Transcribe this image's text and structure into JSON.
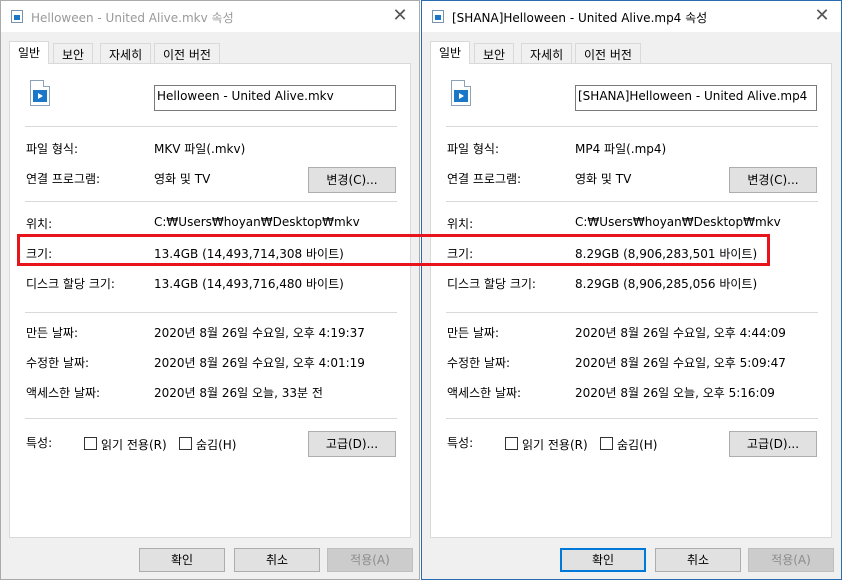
{
  "windows": [
    {
      "title": "Helloween - United Alive.mkv 속성",
      "tabs": [
        "일반",
        "보안",
        "자세히",
        "이전 버전"
      ],
      "file_name": "Helloween - United Alive.mkv",
      "labels": {
        "type": "파일 형식:",
        "opens_with": "연결 프로그램:",
        "location": "위치:",
        "size": "크기:",
        "size_on_disk": "디스크 할당 크기:",
        "created": "만든 날짜:",
        "modified": "수정한 날짜:",
        "accessed": "액세스한 날짜:",
        "attributes": "특성:"
      },
      "values": {
        "type": "MKV 파일(.mkv)",
        "opens_with": "영화 및 TV",
        "location": "C:₩Users₩hoyan₩Desktop₩mkv",
        "size": "13.4GB (14,493,714,308 바이트)",
        "size_on_disk": "13.4GB (14,493,716,480 바이트)",
        "created": "2020년 8월 26일 수요일, 오후 4:19:37",
        "modified": "2020년 8월 26일 수요일, 오후 4:01:19",
        "accessed": "2020년 8월 26일 오늘, 33분 전"
      },
      "change_button": "변경(C)...",
      "readonly_label": "읽기 전용(R)",
      "hidden_label": "숨김(H)",
      "advanced_button": "고급(D)...",
      "ok_button": "확인",
      "cancel_button": "취소",
      "apply_button": "적용(A)"
    },
    {
      "title": "[SHANA]Helloween - United Alive.mp4 속성",
      "tabs": [
        "일반",
        "보안",
        "자세히",
        "이전 버전"
      ],
      "file_name": "[SHANA]Helloween - United Alive.mp4",
      "labels": {
        "type": "파일 형식:",
        "opens_with": "연결 프로그램:",
        "location": "위치:",
        "size": "크기:",
        "size_on_disk": "디스크 할당 크기:",
        "created": "만든 날짜:",
        "modified": "수정한 날짜:",
        "accessed": "액세스한 날짜:",
        "attributes": "특성:"
      },
      "values": {
        "type": "MP4 파일(.mp4)",
        "opens_with": "영화 및 TV",
        "location": "C:₩Users₩hoyan₩Desktop₩mkv",
        "size": "8.29GB (8,906,283,501 바이트)",
        "size_on_disk": "8.29GB (8,906,285,056 바이트)",
        "created": "2020년 8월 26일 수요일, 오후 4:44:09",
        "modified": "2020년 8월 26일 수요일, 오후 5:09:47",
        "accessed": "2020년 8월 26일 오늘, 오후 5:16:09"
      },
      "change_button": "변경(C)...",
      "readonly_label": "읽기 전용(R)",
      "hidden_label": "숨김(H)",
      "advanced_button": "고급(D)...",
      "ok_button": "확인",
      "cancel_button": "취소",
      "apply_button": "적용(A)"
    }
  ],
  "highlight_color": "#e8141c",
  "close_glyph": "✕"
}
